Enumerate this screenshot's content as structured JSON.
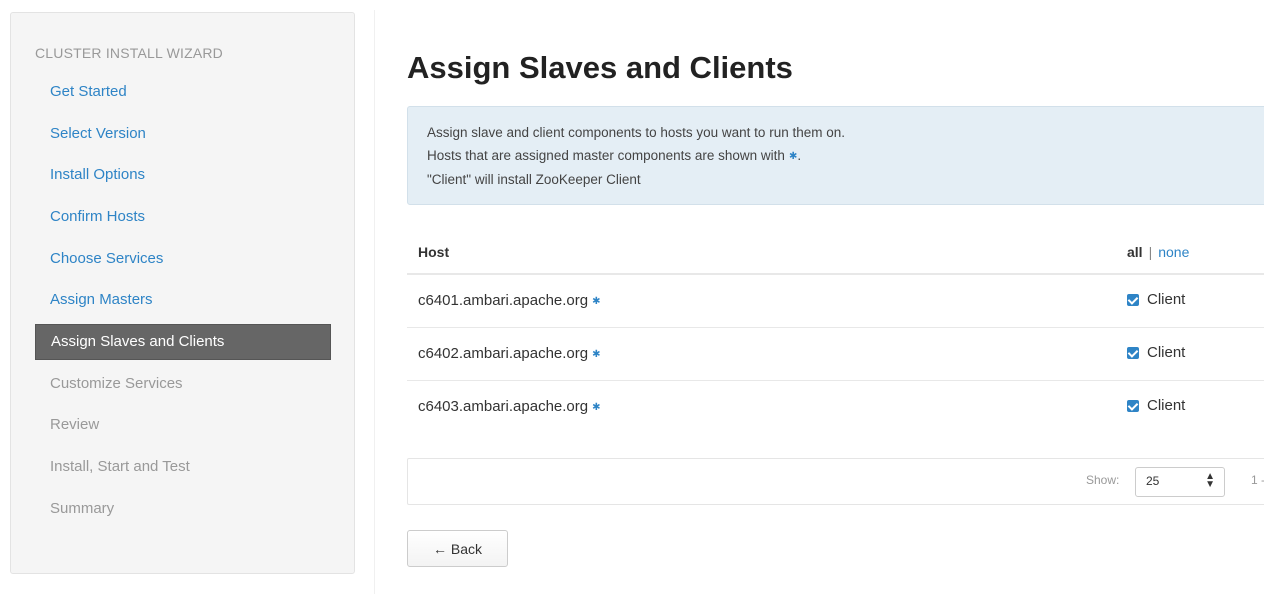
{
  "sidebar": {
    "header": "CLUSTER INSTALL WIZARD",
    "steps": [
      {
        "label": "Get Started",
        "state": "done"
      },
      {
        "label": "Select Version",
        "state": "done"
      },
      {
        "label": "Install Options",
        "state": "done"
      },
      {
        "label": "Confirm Hosts",
        "state": "done"
      },
      {
        "label": "Choose Services",
        "state": "done"
      },
      {
        "label": "Assign Masters",
        "state": "done"
      },
      {
        "label": "Assign Slaves and Clients",
        "state": "active"
      },
      {
        "label": "Customize Services",
        "state": "pending"
      },
      {
        "label": "Review",
        "state": "pending"
      },
      {
        "label": "Install, Start and Test",
        "state": "pending"
      },
      {
        "label": "Summary",
        "state": "pending"
      }
    ]
  },
  "main": {
    "title": "Assign Slaves and Clients",
    "info": {
      "line1": "Assign slave and client components to hosts you want to run them on.",
      "line2_prefix": "Hosts that are assigned master components are shown with",
      "line2_suffix": ".",
      "line3": "\"Client\" will install ZooKeeper Client",
      "master_marker": "✱"
    },
    "table": {
      "host_header": "Host",
      "all_label": "all",
      "separator": "|",
      "none_label": "none",
      "rows": [
        {
          "host": "c6401.ambari.apache.org",
          "client_label": "Client",
          "checked": true
        },
        {
          "host": "c6402.ambari.apache.org",
          "client_label": "Client",
          "checked": true
        },
        {
          "host": "c6403.ambari.apache.org",
          "client_label": "Client",
          "checked": true
        }
      ]
    },
    "pager": {
      "show_label": "Show:",
      "page_size": "25",
      "range": "1 -"
    },
    "back_label": "← Back"
  },
  "colors": {
    "link": "#2e84c6",
    "active_step_bg": "#666666",
    "info_bg": "#e4eef5"
  }
}
